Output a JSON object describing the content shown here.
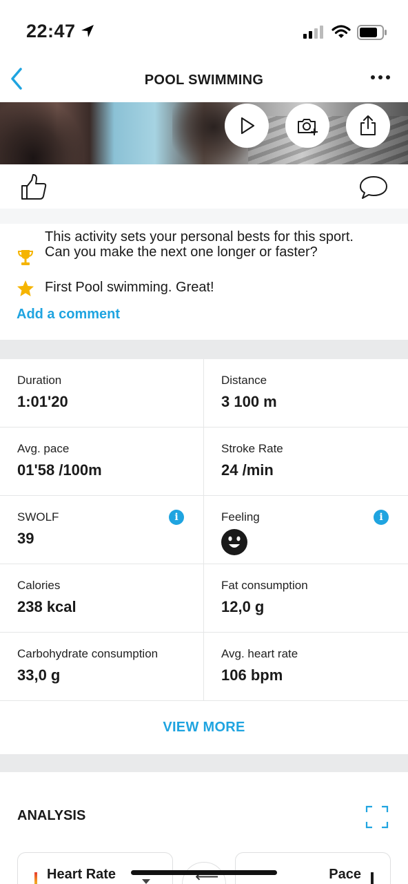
{
  "status_bar": {
    "time": "22:47"
  },
  "nav": {
    "title": "POOL SWIMMING"
  },
  "media": {
    "buttons": [
      "play-icon",
      "add-photo-icon",
      "share-icon"
    ]
  },
  "reactions": {
    "like": "thumbs-up-icon",
    "comment": "comment-bubble-icon"
  },
  "achievements": [
    {
      "icon": "trophy-icon",
      "text": "This activity sets your personal bests for this sport. Can you make the next one longer or faster?"
    },
    {
      "icon": "star-icon",
      "text": "First Pool swimming. Great!"
    }
  ],
  "add_comment_label": "Add a comment",
  "stats": [
    {
      "label": "Duration",
      "value": "1:01'20"
    },
    {
      "label": "Distance",
      "value": "3 100 m"
    },
    {
      "label": "Avg. pace",
      "value": "01'58 /100m"
    },
    {
      "label": "Stroke Rate",
      "value": "24 /min"
    },
    {
      "label": "SWOLF",
      "value": "39",
      "info": "i"
    },
    {
      "label": "Feeling",
      "value": "",
      "info": "i"
    },
    {
      "label": "Calories",
      "value": "238 kcal"
    },
    {
      "label": "Fat consumption",
      "value": "12,0 g"
    },
    {
      "label": "Carbohydrate consumption",
      "value": "33,0 g"
    },
    {
      "label": "Avg. heart rate",
      "value": "106 bpm"
    }
  ],
  "view_more_label": "VIEW MORE",
  "analysis": {
    "title": "ANALYSIS",
    "left_graph": "Heart Rate",
    "right_graph": "Pace",
    "swap_symbol": "⟵"
  },
  "colors": {
    "accent": "#1fa4e0",
    "trophy": "#f5b400",
    "section_gap": "#e9eaeb"
  }
}
